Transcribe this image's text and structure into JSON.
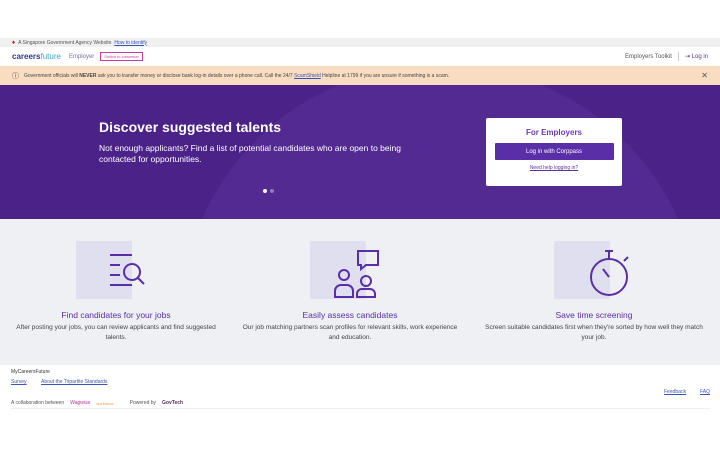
{
  "gov_bar": {
    "text": "A Singapore Government Agency Website",
    "link": "How to identify"
  },
  "nav": {
    "logo_main": "careers",
    "logo_sub": "future",
    "section": "Employer",
    "switch_label": "Switch to jobseeker",
    "toolkit": "Employers Toolkit",
    "login": "Log in"
  },
  "warning": {
    "pre": "Government officials will",
    "bold": "NEVER",
    "mid": "ask you to transfer money or disclose bank log-in details over a phone call. Call the 24/7",
    "link": "ScamShield",
    "post": "Helpline at 1799 if you are unsure if something is a scam."
  },
  "hero": {
    "title": "Discover suggested talents",
    "text": "Not enough applicants? Find a list of potential candidates who are open to being contacted for opportunities.",
    "card_title": "For Employers",
    "card_button": "Log in with Corppass",
    "card_link": "Need help logging in?",
    "slide_count": 2,
    "active_slide": 1
  },
  "features": [
    {
      "title": "Find candidates for your jobs",
      "text": "After posting your jobs, you can review applicants and find suggested talents."
    },
    {
      "title": "Easily assess candidates",
      "text": "Our job matching partners scan profiles for relevant skills, work experience and education."
    },
    {
      "title": "Save time screening",
      "text": "Screen suitable candidates first when they're sorted by how well they match your job."
    }
  ],
  "footer": {
    "brand": "MyCareersFuture",
    "links": [
      "Survey",
      "About the Tripartite Standards"
    ],
    "collab": "A collaboration between",
    "partner1": "Wagwise",
    "partner2": "workforce",
    "powered": "Powered by",
    "powered_logo": "GovTech",
    "right_links": [
      "Feedback",
      "FAQ"
    ]
  }
}
